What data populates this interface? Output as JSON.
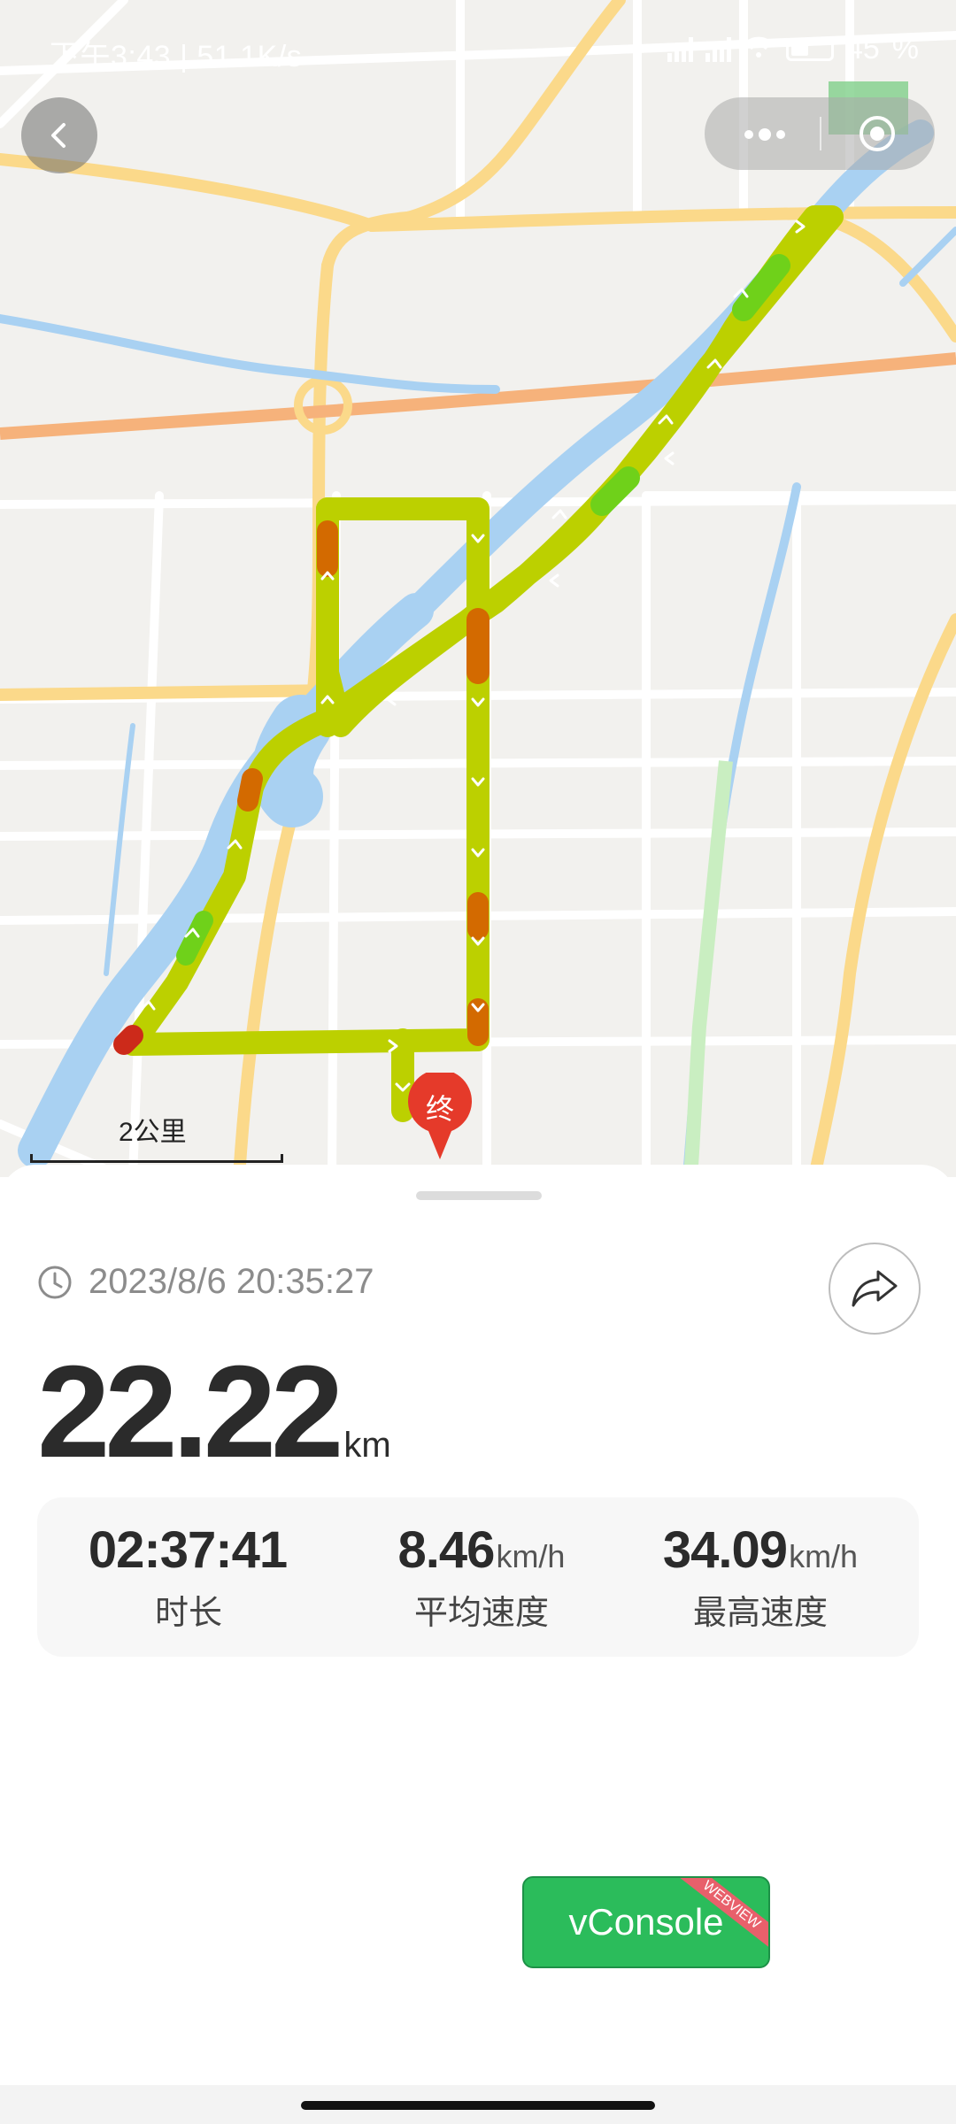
{
  "status_bar": {
    "time_speed": "下午3:43 | 51.1K/s",
    "battery_percent": "45"
  },
  "nav": {
    "back_icon": "chevron-left-icon",
    "more_icon": "more-dots-icon",
    "target_icon": "target-icon"
  },
  "map": {
    "scale_label": "2公里",
    "end_marker_label": "终"
  },
  "track": {
    "datetime": "2023/8/6 20:35:27",
    "distance": "22.22",
    "distance_unit": "km",
    "stats": [
      {
        "value": "02:37:41",
        "unit": "",
        "label": "时长"
      },
      {
        "value": "8.46",
        "unit": "km/h",
        "label": "平均速度"
      },
      {
        "value": "34.09",
        "unit": "km/h",
        "label": "最高速度"
      }
    ]
  },
  "vconsole": {
    "label": "vConsole",
    "ribbon": "WEBVIEW"
  },
  "colors": {
    "route_primary": "#bcd000",
    "route_fast": "#6fd11a",
    "route_slow": "#d36a00",
    "end_marker": "#e53a2a",
    "vconsole_green": "#2bbc5b"
  }
}
